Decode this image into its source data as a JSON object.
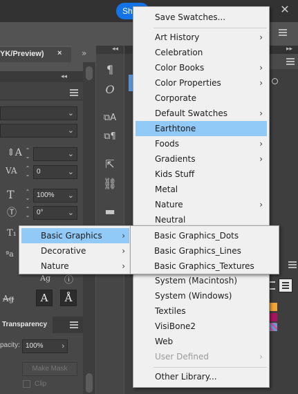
{
  "topbar": {
    "share_label": "Sh",
    "close_glyph": "✕"
  },
  "document": {
    "tab_label": "YK/Preview)",
    "tab_close": "×",
    "collapse_glyph": "»"
  },
  "character_panel": {
    "leading_value": "",
    "kerning_value": "0",
    "scale_value": "100%",
    "rotate_value": "0°"
  },
  "transparency_panel": {
    "tab_label": "Transparency",
    "opacity_label": "pacity:",
    "opacity_value": "100%",
    "make_mask_label": "Make Mask",
    "clip_label": "Clip"
  },
  "swatch_library_menu": {
    "items": [
      {
        "label": "Save Swatches...",
        "submenu": false,
        "highlighted": false,
        "disabled": false
      },
      {
        "label": "Art History",
        "submenu": true,
        "highlighted": false,
        "disabled": false
      },
      {
        "label": "Celebration",
        "submenu": false,
        "highlighted": false,
        "disabled": false
      },
      {
        "label": "Color Books",
        "submenu": true,
        "highlighted": false,
        "disabled": false
      },
      {
        "label": "Color Properties",
        "submenu": true,
        "highlighted": false,
        "disabled": false
      },
      {
        "label": "Corporate",
        "submenu": false,
        "highlighted": false,
        "disabled": false
      },
      {
        "label": "Default Swatches",
        "submenu": true,
        "highlighted": false,
        "disabled": false
      },
      {
        "label": "Earthtone",
        "submenu": false,
        "highlighted": true,
        "disabled": false
      },
      {
        "label": "Foods",
        "submenu": true,
        "highlighted": false,
        "disabled": false
      },
      {
        "label": "Gradients",
        "submenu": true,
        "highlighted": false,
        "disabled": false
      },
      {
        "label": "Kids Stuff",
        "submenu": false,
        "highlighted": false,
        "disabled": false
      },
      {
        "label": "Metal",
        "submenu": false,
        "highlighted": false,
        "disabled": false
      },
      {
        "label": "Nature",
        "submenu": true,
        "highlighted": false,
        "disabled": false
      },
      {
        "label": "Neutral",
        "submenu": false,
        "highlighted": false,
        "disabled": false
      },
      {
        "label": "System (Macintosh)",
        "submenu": false,
        "highlighted": false,
        "disabled": false
      },
      {
        "label": "System (Windows)",
        "submenu": false,
        "highlighted": false,
        "disabled": false
      },
      {
        "label": "Textiles",
        "submenu": false,
        "highlighted": false,
        "disabled": false
      },
      {
        "label": "VisiBone2",
        "submenu": false,
        "highlighted": false,
        "disabled": false
      },
      {
        "label": "Web",
        "submenu": false,
        "highlighted": false,
        "disabled": false
      },
      {
        "label": "User Defined",
        "submenu": true,
        "highlighted": false,
        "disabled": true
      },
      {
        "label": "Other Library...",
        "submenu": false,
        "highlighted": false,
        "disabled": false
      }
    ]
  },
  "symbol_library_menu": {
    "items": [
      {
        "label": "Basic Graphics",
        "submenu": true,
        "highlighted": true
      },
      {
        "label": "Decorative",
        "submenu": true,
        "highlighted": false
      },
      {
        "label": "Nature",
        "submenu": true,
        "highlighted": false
      }
    ]
  },
  "basic_graphics_submenu": {
    "items": [
      {
        "label": "Basic Graphics_Dots"
      },
      {
        "label": "Basic Graphics_Lines"
      },
      {
        "label": "Basic Graphics_Textures"
      }
    ]
  },
  "colors": {
    "menu_bg": "#f0f0f0",
    "highlight": "#91c9f7",
    "share_blue": "#1473e6"
  }
}
